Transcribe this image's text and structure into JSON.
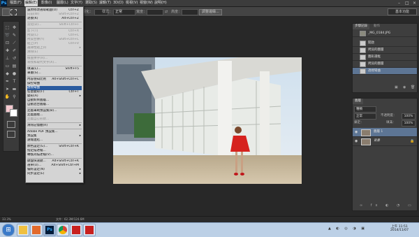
{
  "app": {
    "logo": "Ps"
  },
  "menubar": [
    {
      "label": "檔案(F)"
    },
    {
      "label": "編輯(E)"
    },
    {
      "label": "影像(I)"
    },
    {
      "label": "圖層(L)"
    },
    {
      "label": "文字(Y)"
    },
    {
      "label": "選取(S)"
    },
    {
      "label": "濾鏡(T)"
    },
    {
      "label": "3D(D)"
    },
    {
      "label": "檢視(V)"
    },
    {
      "label": "視窗(W)"
    },
    {
      "label": "說明(H)"
    }
  ],
  "options_bar": {
    "feather_label": "羽化：",
    "style_label": "樣式：",
    "style_value": "正常",
    "width_label": "寬度：",
    "height_label": "高度：",
    "refine_label": "調整邊緣...",
    "workspace_preset": "基本功能"
  },
  "edit_menu": [
    {
      "label": "還原修改選取範圍(O)",
      "shortcut": "Ctrl+Z",
      "disabled": false
    },
    {
      "label": "向前(W)",
      "shortcut": "Shift+Ctrl+Z",
      "disabled": true
    },
    {
      "label": "退後(K)",
      "shortcut": "Alt+Ctrl+Z",
      "disabled": false
    },
    {
      "sep": true
    },
    {
      "label": "淡化(D)...",
      "shortcut": "Shift+Ctrl+F",
      "disabled": true
    },
    {
      "sep": true
    },
    {
      "label": "剪下(T)",
      "shortcut": "Ctrl+X",
      "disabled": true
    },
    {
      "label": "拷貝(C)",
      "shortcut": "Ctrl+C",
      "disabled": true
    },
    {
      "label": "拷貝合併(Y)",
      "shortcut": "Shift+Ctrl+C",
      "disabled": true
    },
    {
      "label": "貼上(P)",
      "shortcut": "Ctrl+V",
      "disabled": true
    },
    {
      "label": "選擇性貼上(I)",
      "submenu": true,
      "disabled": true
    },
    {
      "label": "清除(E)",
      "disabled": true
    },
    {
      "sep": true
    },
    {
      "label": "檢查拼字(H)...",
      "disabled": true
    },
    {
      "label": "尋找和取代文字(X)...",
      "disabled": true
    },
    {
      "sep": true
    },
    {
      "label": "填滿(L)...",
      "shortcut": "Shift+F5",
      "disabled": false
    },
    {
      "label": "筆畫(S)...",
      "disabled": false
    },
    {
      "sep": true
    },
    {
      "label": "內容感知比例",
      "shortcut": "Alt+Shift+Ctrl+C",
      "disabled": false
    },
    {
      "label": "操控彎曲",
      "disabled": false
    },
    {
      "label": "透視彎曲",
      "disabled": false,
      "highlight": true
    },
    {
      "label": "任意變形(F)",
      "shortcut": "Ctrl+T",
      "disabled": false
    },
    {
      "label": "變形(A)",
      "submenu": true,
      "disabled": false
    },
    {
      "label": "自動對齊圖層...",
      "disabled": false
    },
    {
      "label": "自動混合圖層...",
      "disabled": false
    },
    {
      "sep": true
    },
    {
      "label": "定義筆刷預設集(B)...",
      "disabled": false
    },
    {
      "label": "定義圖樣...",
      "disabled": false
    },
    {
      "label": "定義自訂形狀...",
      "disabled": true
    },
    {
      "sep": true
    },
    {
      "label": "清除記憶體(R)",
      "submenu": true,
      "disabled": false
    },
    {
      "sep": true
    },
    {
      "label": "Adobe PDF 預設集...",
      "disabled": false
    },
    {
      "label": "預設集",
      "submenu": true,
      "disabled": false
    },
    {
      "label": "遠端連結...",
      "disabled": false
    },
    {
      "sep": true
    },
    {
      "label": "顏色設定(G)...",
      "shortcut": "Shift+Ctrl+K",
      "disabled": false
    },
    {
      "label": "指定描述檔...",
      "disabled": false
    },
    {
      "label": "轉換為描述檔(V)...",
      "disabled": false
    },
    {
      "sep": true
    },
    {
      "label": "鍵盤快速鍵...",
      "shortcut": "Alt+Shift+Ctrl+K",
      "disabled": false
    },
    {
      "label": "選單(U)...",
      "shortcut": "Alt+Shift+Ctrl+M",
      "disabled": false
    },
    {
      "label": "偏好設定(N)",
      "submenu": true,
      "disabled": false
    },
    {
      "label": "同步設定(E)",
      "submenu": true,
      "disabled": false
    }
  ],
  "history_panel": {
    "tabs": [
      "步驟記錄",
      "動作"
    ],
    "snapshot": "_MG_0184.JPG",
    "items": [
      {
        "label": "開啟",
        "selected": false
      },
      {
        "label": "拷貝的圖層",
        "selected": false
      },
      {
        "label": "圖形選框",
        "selected": false
      },
      {
        "label": "拷貝的圖層",
        "selected": false
      },
      {
        "label": "透視彎曲",
        "selected": true
      }
    ]
  },
  "layers_panel": {
    "tab": "圖層",
    "kind_label": "種類",
    "blend_mode": "正常",
    "opacity_label": "不透明度：",
    "opacity_value": "100%",
    "lock_label": "鎖定：",
    "fill_label": "填滿：",
    "fill_value": "100%",
    "layers": [
      {
        "name": "圖層 1",
        "selected": true
      },
      {
        "name": "背景",
        "selected": false
      }
    ]
  },
  "status": {
    "zoom": "33.3%",
    "doc": "文件：62.3M/124.6M"
  },
  "taskbar": {
    "time": "上午 11:51",
    "date": "2014/11/07"
  }
}
